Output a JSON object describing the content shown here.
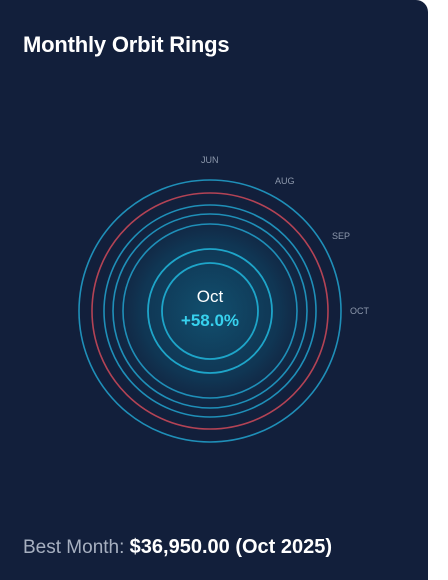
{
  "card": {
    "title": "Monthly Orbit Rings"
  },
  "orbit": {
    "month_labels": [
      "JUN",
      "AUG",
      "SEP",
      "OCT"
    ],
    "center_month": "Oct",
    "center_change": "+58.0%",
    "ring_color": "#1f8fb8",
    "highlight_ring_color": "#b34355",
    "accent_color": "#37d1ee"
  },
  "summary": {
    "label": "Best Month:",
    "value": "$36,950.00 (Oct 2025)"
  }
}
